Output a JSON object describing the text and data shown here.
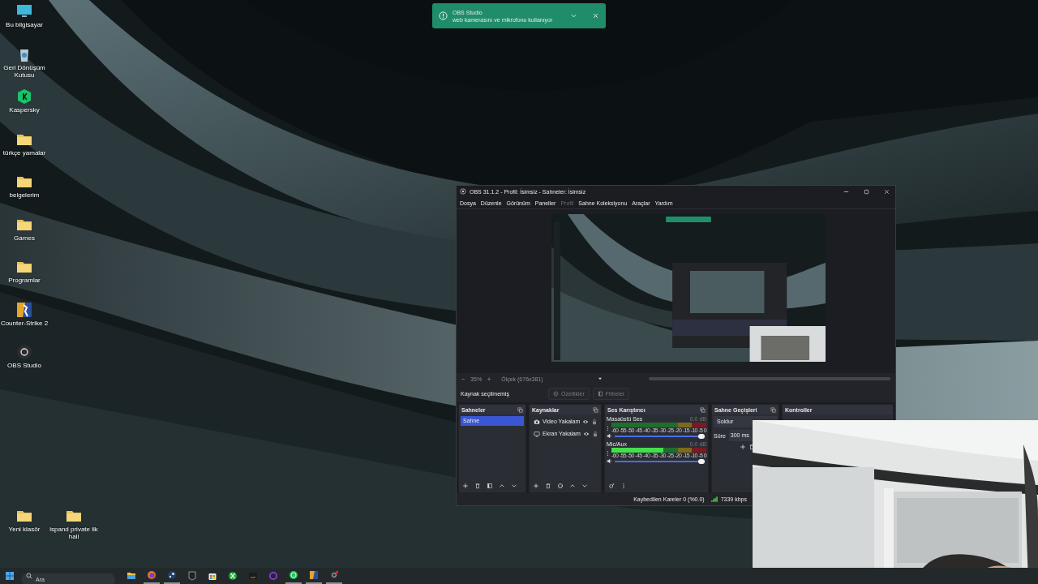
{
  "desktop_icons": [
    {
      "label": "Bu bilgisayar",
      "kind": "monitor"
    },
    {
      "label": "Geri Dönüşüm Kutusu",
      "kind": "bin"
    },
    {
      "label": "Kaspersky",
      "kind": "kaspersky"
    },
    {
      "label": "türkçe yamalar",
      "kind": "folder"
    },
    {
      "label": "belgelerim",
      "kind": "folder"
    },
    {
      "label": "Games",
      "kind": "folder"
    },
    {
      "label": "Programlar",
      "kind": "folder"
    },
    {
      "label": "Counter-Strike 2",
      "kind": "cs"
    },
    {
      "label": "OBS Studio",
      "kind": "obs"
    }
  ],
  "desktop_icons_bottom": [
    {
      "label": "Yeni klasör",
      "kind": "folder"
    },
    {
      "label": "ispand private ilk hali",
      "kind": "folder"
    }
  ],
  "notification": {
    "title": "OBS Studio",
    "message": "web kamerasını ve mikrofonu kullanıyor"
  },
  "obs_window": {
    "title": "OBS 31.1.2 - Profil: İsimsiz - Sahneler: İsimsiz",
    "menu": [
      {
        "label": "Dosya",
        "disabled": false
      },
      {
        "label": "Düzenle",
        "disabled": false
      },
      {
        "label": "Görünüm",
        "disabled": false
      },
      {
        "label": "Paneller",
        "disabled": false
      },
      {
        "label": "Profil",
        "disabled": true
      },
      {
        "label": "Sahne Koleksiyonu",
        "disabled": false
      },
      {
        "label": "Araçlar",
        "disabled": false
      },
      {
        "label": "Yardım",
        "disabled": false
      }
    ],
    "zoom_bar": {
      "minus": "−",
      "zoom": "35%",
      "plus": "+",
      "scale": "Ölçek (676x381)"
    },
    "source_bar": {
      "status": "Kaynak seçilmemiş",
      "properties": "Özellikler",
      "filters": "Filtreler"
    },
    "scenes": {
      "title": "Sahneler",
      "items": [
        {
          "label": "Sahne",
          "selected": true
        }
      ]
    },
    "sources": {
      "title": "Kaynaklar",
      "items": [
        {
          "label": "Video Yakalam",
          "kind": "camera"
        },
        {
          "label": "Ekran Yakalam",
          "kind": "monitor"
        }
      ]
    },
    "mixer": {
      "title": "Ses Karıştırıcı",
      "channels": [
        {
          "name": "Masaüstü Ses",
          "reading": "0.0 dB",
          "meter": {
            "level": 0
          },
          "scale": [
            "-60",
            "-55",
            "-50",
            "-45",
            "-40",
            "-35",
            "-30",
            "-25",
            "-20",
            "-15",
            "-10",
            "-5",
            "0"
          ],
          "volume": {
            "level": 1
          }
        },
        {
          "name": "Mic/Aux",
          "reading": "0.0 dB",
          "meter": {
            "level": 0.55
          },
          "scale": [
            "-60",
            "-55",
            "-50",
            "-45",
            "-40",
            "-35",
            "-30",
            "-25",
            "-20",
            "-15",
            "-10",
            "-5",
            "0"
          ],
          "volume": {
            "level": 1
          }
        }
      ]
    },
    "transitions": {
      "title": "Sahne Geçişleri",
      "transition": "Soldur",
      "duration_label": "Süre",
      "duration": "300 ms"
    },
    "controls": {
      "title": "Kontroller"
    },
    "status_bar": {
      "dropped_frames": "Kaybedilen Kareler 0 (%0.0)",
      "bitrate": "7339 kbps"
    }
  },
  "taskbar": {
    "search_placeholder": "Ara",
    "apps": [
      {
        "kind": "explorer",
        "running": false
      },
      {
        "kind": "firefox",
        "running": true
      },
      {
        "kind": "steam",
        "running": true
      },
      {
        "kind": "epic",
        "running": false
      },
      {
        "kind": "store",
        "running": false
      },
      {
        "kind": "xbox",
        "running": false
      },
      {
        "kind": "amazon",
        "running": false
      },
      {
        "kind": "ring",
        "running": false
      },
      {
        "kind": "whatsapp",
        "running": true
      },
      {
        "kind": "cs",
        "running": true
      },
      {
        "kind": "obs",
        "running": true
      }
    ]
  }
}
